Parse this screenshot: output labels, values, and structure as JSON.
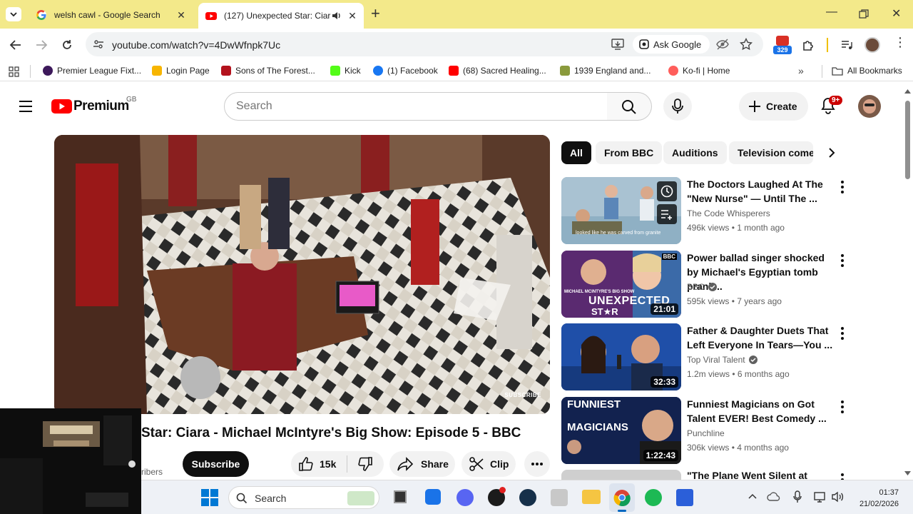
{
  "browser": {
    "tabs": [
      {
        "title": "welsh cawl - Google Search",
        "active": false
      },
      {
        "title": "(127) Unexpected Star: Ciara",
        "active": true
      }
    ],
    "url": "youtube.com/watch?v=4DwWfnpk7Uc",
    "ask_google": "Ask Google",
    "extension_badge": "329",
    "bookmarks": [
      {
        "label": "Premier League Fixt...",
        "color": "#3d195b"
      },
      {
        "label": "Login Page",
        "color": "#f7b500"
      },
      {
        "label": "Sons of The Forest...",
        "color": "#b3121d"
      },
      {
        "label": "Kick",
        "color": "#53fc18"
      },
      {
        "label": "(1) Facebook",
        "color": "#1877f2"
      },
      {
        "label": "(68) Sacred Healing...",
        "color": "#ff0000"
      },
      {
        "label": "1939 England and...",
        "color": "#8a9a3c"
      },
      {
        "label": "Ko-fi | Home",
        "color": "#ff5e5b"
      }
    ],
    "all_bookmarks": "All Bookmarks"
  },
  "youtube": {
    "logo_text": "Premium",
    "region": "GB",
    "search_placeholder": "Search",
    "create_label": "Create",
    "notifications": "9+",
    "video_title": "Star: Ciara - Michael McIntyre's Big Show: Episode 5 - BBC",
    "subscribers_partial": "ribers",
    "subscribe_label": "Subscribe",
    "likes": "15k",
    "share_label": "Share",
    "clip_label": "Clip",
    "player_watermark": "SUBSCRIBE",
    "chips": [
      "All",
      "From BBC",
      "Auditions",
      "Television come"
    ],
    "recommendations": [
      {
        "title": "The Doctors Laughed At The \"New Nurse\" — Until The ...",
        "channel": "The Code Whisperers",
        "verified": false,
        "views": "496k views",
        "age": "1 month ago",
        "duration": "",
        "thumb_color": "#9fb6c6"
      },
      {
        "title": "Power ballad singer shocked by Michael's Egyptian tomb prank...",
        "channel": "BBC",
        "verified": true,
        "views": "595k views",
        "age": "7 years ago",
        "duration": "21:01",
        "thumb_color": "#6a2a6e"
      },
      {
        "title": "Father & Daughter Duets That Left Everyone In Tears—You ...",
        "channel": "Top Viral Talent",
        "verified": true,
        "views": "1.2m views",
        "age": "6 months ago",
        "duration": "32:33",
        "thumb_color": "#1f4fa8"
      },
      {
        "title": "Funniest Magicians on Got Talent EVER! Best Comedy ...",
        "channel": "Punchline",
        "verified": false,
        "views": "306k views",
        "age": "4 months ago",
        "duration": "1:22:43",
        "thumb_color": "#1b2d6b"
      },
      {
        "title": "\"The Plane Went Silent at",
        "channel": "",
        "verified": false,
        "views": "",
        "age": "",
        "duration": "",
        "thumb_color": "#cfcfcf"
      }
    ],
    "thumb_text": {
      "rec1_caption": "looked like he was carved from granite",
      "rec2_big": "UNEXPECTED",
      "rec2_star": "ST★R",
      "rec2_bbc": "BBC",
      "rec4_line1": "FUNNIEST",
      "rec4_line2": "MAGICIANS"
    }
  },
  "taskbar": {
    "search_label": "Search",
    "time": "01:37",
    "date": "21/02/2026"
  }
}
